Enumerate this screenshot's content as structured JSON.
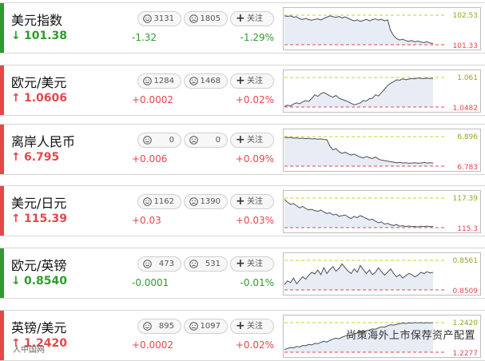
{
  "colors": {
    "up": "#e5474b",
    "down": "#2e9b2e",
    "ref_high": "#c4d12a",
    "ref_low": "#e5474b",
    "area_fill": "#e7ecf5",
    "line": "#4a4f57"
  },
  "quotes": [
    {
      "name": "美元指数",
      "direction": "down",
      "price": "101.38",
      "change": "-1.32",
      "pct": "-1.29%",
      "likes": "3131",
      "dislikes": "1805",
      "follow_label": "关注",
      "chart_data": {
        "type": "line",
        "high_label": "102.53",
        "low_label": "101.33",
        "ylim": [
          101.33,
          102.53
        ],
        "y": [
          102.5,
          102.48,
          102.5,
          102.45,
          102.47,
          102.38,
          102.36,
          102.4,
          102.35,
          102.33,
          102.36,
          102.38,
          102.34,
          102.4,
          102.45,
          102.5,
          102.47,
          102.44,
          102.48,
          102.42,
          102.46,
          102.4,
          102.35,
          102.3,
          102.34,
          102.28,
          102.32,
          102.36,
          102.3,
          102.35,
          102.38,
          102.33,
          102.36,
          102.3,
          102.34,
          101.9,
          101.7,
          101.58,
          101.52,
          101.55,
          101.5,
          101.47,
          101.5,
          101.45,
          101.48,
          101.44,
          101.42,
          101.45,
          101.4,
          101.38
        ]
      }
    },
    {
      "name": "欧元/美元",
      "direction": "up",
      "price": "1.0606",
      "change": "+0.0002",
      "pct": "+0.02%",
      "likes": "1284",
      "dislikes": "1468",
      "follow_label": "关注",
      "chart_data": {
        "type": "line",
        "high_label": "1.061",
        "low_label": "1.0482",
        "ylim": [
          1.0482,
          1.061
        ],
        "y": [
          1.0485,
          1.049,
          1.0486,
          1.0495,
          1.05,
          1.0496,
          1.0505,
          1.051,
          1.0506,
          1.052,
          1.0535,
          1.0528,
          1.054,
          1.0545,
          1.0538,
          1.053,
          1.0525,
          1.0532,
          1.052,
          1.0515,
          1.051,
          1.0505,
          1.0498,
          1.0492,
          1.0495,
          1.05,
          1.051,
          1.0508,
          1.0518,
          1.052,
          1.0535,
          1.053,
          1.0545,
          1.056,
          1.0575,
          1.0585,
          1.0592,
          1.06,
          1.0598,
          1.0604,
          1.06,
          1.0603,
          1.0606,
          1.0604,
          1.0608,
          1.0606,
          1.0605,
          1.0607,
          1.0606,
          1.0606
        ]
      }
    },
    {
      "name": "离岸人民币",
      "direction": "up",
      "price": "6.795",
      "change": "+0.006",
      "pct": "+0.09%",
      "likes": "0",
      "dislikes": "0",
      "follow_label": "关注",
      "chart_data": {
        "type": "line",
        "high_label": "6.896",
        "low_label": "6.783",
        "ylim": [
          6.783,
          6.896
        ],
        "y": [
          6.893,
          6.892,
          6.893,
          6.89,
          6.891,
          6.889,
          6.89,
          6.888,
          6.889,
          6.887,
          6.888,
          6.886,
          6.887,
          6.885,
          6.884,
          6.86,
          6.845,
          6.85,
          6.838,
          6.832,
          6.836,
          6.83,
          6.825,
          6.829,
          6.822,
          6.818,
          6.814,
          6.82,
          6.815,
          6.812,
          6.818,
          6.81,
          6.806,
          6.804,
          6.802,
          6.8,
          6.798,
          6.796,
          6.797,
          6.795,
          6.796,
          6.794,
          6.795,
          6.796,
          6.794,
          6.795,
          6.797,
          6.795,
          6.796,
          6.795
        ]
      }
    },
    {
      "name": "美元/日元",
      "direction": "up",
      "price": "115.39",
      "change": "+0.03",
      "pct": "+0.03%",
      "likes": "1162",
      "dislikes": "1390",
      "follow_label": "关注",
      "chart_data": {
        "type": "line",
        "high_label": "117.39",
        "low_label": "115.3",
        "ylim": [
          115.3,
          117.39
        ],
        "y": [
          117.3,
          117.1,
          116.95,
          117.0,
          116.85,
          116.7,
          116.8,
          116.65,
          116.55,
          116.6,
          116.5,
          116.45,
          116.55,
          116.4,
          116.3,
          116.35,
          116.2,
          116.25,
          116.1,
          116.15,
          116.2,
          116.05,
          115.95,
          116.1,
          116.0,
          116.15,
          116.05,
          115.95,
          115.85,
          115.9,
          115.75,
          115.65,
          115.7,
          115.55,
          115.6,
          115.5,
          115.45,
          115.52,
          115.4,
          115.44,
          115.38,
          115.42,
          115.36,
          115.39,
          115.35,
          115.4,
          115.38,
          115.41,
          115.37,
          115.39
        ]
      }
    },
    {
      "name": "欧元/英镑",
      "direction": "down",
      "price": "0.8540",
      "change": "-0.0001",
      "pct": "-0.01%",
      "likes": "473",
      "dislikes": "531",
      "follow_label": "关注",
      "chart_data": {
        "type": "line",
        "high_label": "0.8561",
        "low_label": "0.8509",
        "ylim": [
          0.8509,
          0.8561
        ],
        "y": [
          0.8518,
          0.8525,
          0.8522,
          0.853,
          0.852,
          0.8526,
          0.8532,
          0.8528,
          0.8535,
          0.854,
          0.8537,
          0.8544,
          0.8536,
          0.8548,
          0.8538,
          0.8545,
          0.855,
          0.8542,
          0.8547,
          0.8555,
          0.8548,
          0.8542,
          0.8538,
          0.8546,
          0.854,
          0.8552,
          0.8545,
          0.8538,
          0.8544,
          0.8536,
          0.854,
          0.8548,
          0.8541,
          0.8535,
          0.854,
          0.8546,
          0.8538,
          0.8532,
          0.8536,
          0.853,
          0.8534,
          0.8538,
          0.8536,
          0.8532,
          0.8535,
          0.854,
          0.8538,
          0.8541,
          0.8539,
          0.854
        ]
      }
    },
    {
      "name": "英镑/美元",
      "direction": "up",
      "price": "1.2420",
      "change": "+0.0002",
      "pct": "+0.02%",
      "likes": "895",
      "dislikes": "1097",
      "follow_label": "关注",
      "chart_data": {
        "type": "line",
        "high_label": "1.2420",
        "low_label": "1.2277",
        "ylim": [
          1.2277,
          1.242
        ],
        "y": [
          1.229,
          1.2295,
          1.23,
          1.2298,
          1.2305,
          1.2302,
          1.231,
          1.2308,
          1.2315,
          1.2312,
          1.232,
          1.2318,
          1.2325,
          1.233,
          1.2326,
          1.2335,
          1.234,
          1.2345,
          1.2342,
          1.235,
          1.2355,
          1.236,
          1.2358,
          1.2365,
          1.237,
          1.2375,
          1.2372,
          1.238,
          1.2385,
          1.239,
          1.2388,
          1.2395,
          1.24,
          1.2398,
          1.2405,
          1.241,
          1.2408,
          1.2412,
          1.2415,
          1.2418,
          1.2416,
          1.2419,
          1.2418,
          1.242,
          1.2419,
          1.242,
          1.2418,
          1.242,
          1.2419,
          1.242
        ]
      }
    }
  ],
  "watermark": {
    "text": "尚策海外上市保荐资产配置",
    "left_text": "人中国网"
  }
}
